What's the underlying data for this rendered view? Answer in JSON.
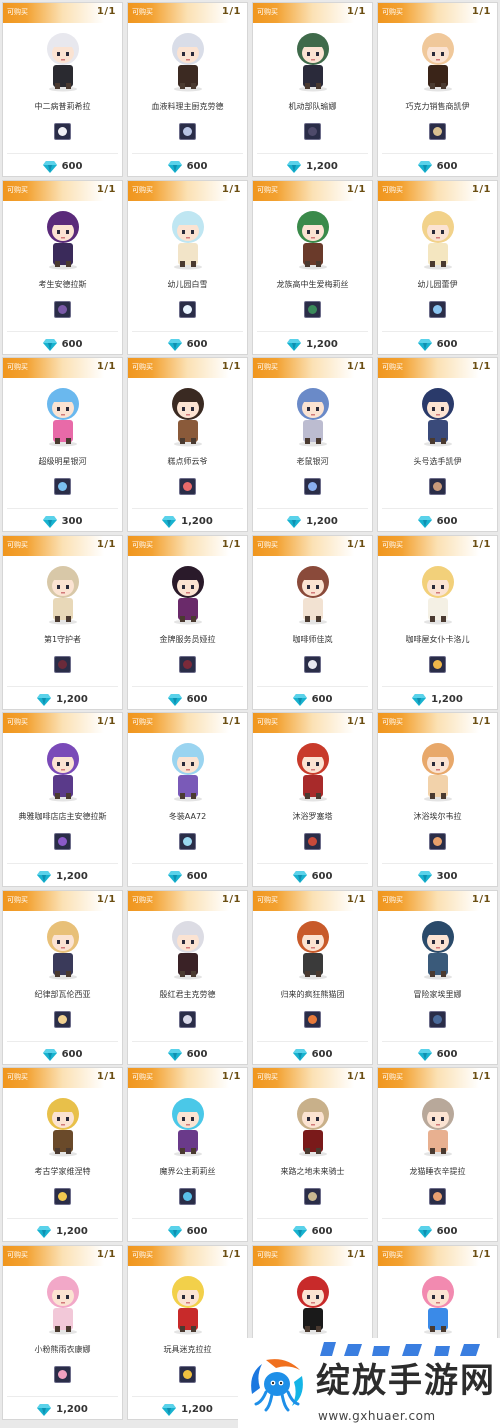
{
  "status_label": "可购买",
  "stock_count": "1/1",
  "currency_icon": "diamond-icon",
  "colors": {
    "header_orange": "#f0961e",
    "diamond_cyan": "#17b2cf",
    "thumb_bg": "#2a2d48"
  },
  "items": [
    {
      "name": "中二病普莉希拉",
      "price": "600",
      "hair": "#e8e8ee",
      "cloth": "#2a2a30",
      "thumb": "#f0f0f4"
    },
    {
      "name": "血液料理主厨克劳德",
      "price": "600",
      "hair": "#d9dde8",
      "cloth": "#3c2a22",
      "thumb": "#b8c4e4"
    },
    {
      "name": "机动部队瑜娜",
      "price": "1,200",
      "hair": "#3f6a4a",
      "cloth": "#2a2a3a",
      "thumb": "#4e4a6a"
    },
    {
      "name": "巧克力销售商凯伊",
      "price": "600",
      "hair": "#f0c89a",
      "cloth": "#3a2418",
      "thumb": "#d8c090"
    },
    {
      "name": "考生安德拉斯",
      "price": "600",
      "hair": "#5a2a7a",
      "cloth": "#3a2a5a",
      "thumb": "#7a5aa8"
    },
    {
      "name": "幼儿园白雪",
      "price": "600",
      "hair": "#bfe6f2",
      "cloth": "#f2e4c8",
      "thumb": "#e8f4ff"
    },
    {
      "name": "龙族高中生爱梅莉丝",
      "price": "1,200",
      "hair": "#3a8a4a",
      "cloth": "#6a3a2a",
      "thumb": "#3a8a5a"
    },
    {
      "name": "幼儿园蕾伊",
      "price": "600",
      "hair": "#f2d28a",
      "cloth": "#f4e6c0",
      "thumb": "#8ac4f0"
    },
    {
      "name": "超级明星银河",
      "price": "300",
      "hair": "#6ab8ee",
      "cloth": "#e86aa8",
      "thumb": "#7ac0f0"
    },
    {
      "name": "糕点师云爷",
      "price": "1,200",
      "hair": "#3a2a22",
      "cloth": "#8a5a3a",
      "thumb": "#e86a6a"
    },
    {
      "name": "老鼠银河",
      "price": "1,200",
      "hair": "#6a8ac8",
      "cloth": "#bcbcd0",
      "thumb": "#8ab0f0"
    },
    {
      "name": "头号选手凯伊",
      "price": "600",
      "hair": "#2a3a6a",
      "cloth": "#3a4a7a",
      "thumb": "#c89a7a"
    },
    {
      "name": "第1守护者",
      "price": "1,200",
      "hair": "#d8c8a8",
      "cloth": "#e8d8b8",
      "thumb": "#6a2a3a"
    },
    {
      "name": "金牌服务员娅拉",
      "price": "600",
      "hair": "#2a1a2a",
      "cloth": "#6a2a6a",
      "thumb": "#7a2a3a"
    },
    {
      "name": "咖啡师佳岚",
      "price": "600",
      "hair": "#8a4a3a",
      "cloth": "#f2e2d2",
      "thumb": "#e8e8f0"
    },
    {
      "name": "咖啡屋女仆卡洛儿",
      "price": "1,200",
      "hair": "#f2d07a",
      "cloth": "#f4f0e4",
      "thumb": "#f0b84a"
    },
    {
      "name": "典雅咖啡店店主安德拉斯",
      "price": "1,200",
      "hair": "#7a4ab8",
      "cloth": "#5a3a8a",
      "thumb": "#8a5ac8"
    },
    {
      "name": "冬装AA72",
      "price": "600",
      "hair": "#9ad4f0",
      "cloth": "#7a5ab8",
      "thumb": "#9ad8f0"
    },
    {
      "name": "沐浴罗塞塔",
      "price": "600",
      "hair": "#c83a2a",
      "cloth": "#a82a2a",
      "thumb": "#c84a3a"
    },
    {
      "name": "沐浴埃尔韦拉",
      "price": "300",
      "hair": "#e8a86a",
      "cloth": "#f2d2aa",
      "thumb": "#e8a06a"
    },
    {
      "name": "纪律部瓦伦西亚",
      "price": "600",
      "hair": "#e8c078",
      "cloth": "#3a3a5a",
      "thumb": "#f0d090"
    },
    {
      "name": "殷红君主克劳德",
      "price": "600",
      "hair": "#dcdce4",
      "cloth": "#3a2226",
      "thumb": "#d8d8e8"
    },
    {
      "name": "归来的疯狂熊猫团",
      "price": "600",
      "hair": "#c85a2a",
      "cloth": "#3a3a3a",
      "thumb": "#e87a3a"
    },
    {
      "name": "冒险家埃里娜",
      "price": "600",
      "hair": "#2a4a6a",
      "cloth": "#3a5a7a",
      "thumb": "#4a6a9a"
    },
    {
      "name": "考古学家维涅特",
      "price": "1,200",
      "hair": "#e8c04a",
      "cloth": "#6a4a2a",
      "thumb": "#f0c850"
    },
    {
      "name": "魔界公主莉莉丝",
      "price": "600",
      "hair": "#4ac8e8",
      "cloth": "#6a3a8a",
      "thumb": "#5ac0e8"
    },
    {
      "name": "来路之地未来骑士",
      "price": "600",
      "hair": "#c8b08a",
      "cloth": "#7a1a1a",
      "thumb": "#c8b890"
    },
    {
      "name": "龙猫睡衣辛提拉",
      "price": "600",
      "hair": "#b8a89a",
      "cloth": "#e8b090",
      "thumb": "#e8a070"
    },
    {
      "name": "小粉熊雨衣康娜",
      "price": "1,200",
      "hair": "#f2a8c8",
      "cloth": "#f2c8d8",
      "thumb": "#f0a0c0"
    },
    {
      "name": "玩具迷克拉拉",
      "price": "1,200",
      "hair": "#f2d04a",
      "cloth": "#c82a2a",
      "thumb": "#f0c040"
    },
    {
      "name": "",
      "price": "",
      "hair": "#c82a2a",
      "cloth": "#1a1a1a",
      "thumb": "#c82a2a"
    },
    {
      "name": "",
      "price": "",
      "hair": "#f28ab0",
      "cloth": "#3a8ae8",
      "thumb": "#f28ab0"
    }
  ],
  "watermark": {
    "title": "绽放手游网",
    "url": "www.gxhuaer.com",
    "logo_icon": "octopus-logo-icon"
  }
}
